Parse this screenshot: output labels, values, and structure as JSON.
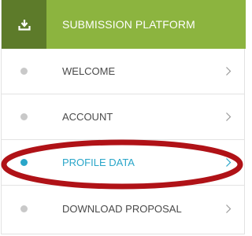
{
  "header": {
    "title": "SUBMISSION PLATFORM",
    "icon": "download-tray-icon"
  },
  "menu": {
    "items": [
      {
        "label": "WELCOME",
        "active": false
      },
      {
        "label": "ACCOUNT",
        "active": false
      },
      {
        "label": "PROFILE DATA",
        "active": true
      },
      {
        "label": "DOWNLOAD PROPOSAL",
        "active": false
      }
    ]
  },
  "colors": {
    "header_dark": "#5d7b2a",
    "header_light": "#8cb43f",
    "active": "#2aa6c9",
    "inactive_bullet": "#c9c9c9",
    "highlight_oval": "#b01217"
  }
}
